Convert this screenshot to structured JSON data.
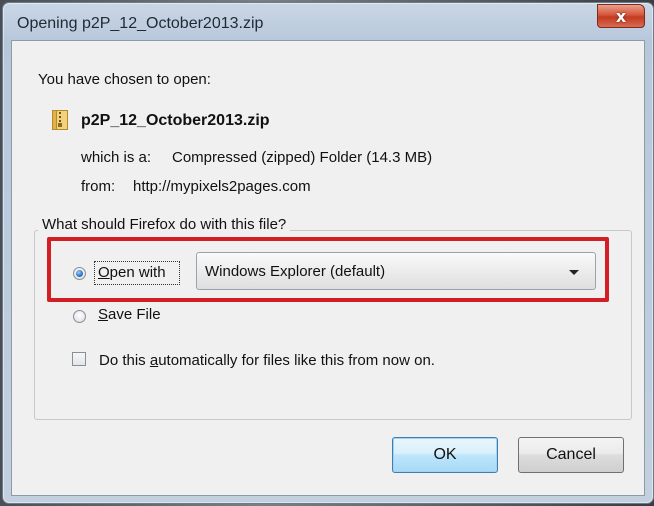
{
  "window": {
    "title": "Opening p2P_12_October2013.zip",
    "close_glyph": "x"
  },
  "dialog": {
    "intro": "You have chosen to open:",
    "filename": "p2P_12_October2013.zip",
    "which_is_label": "which is a:",
    "which_is_value": "Compressed (zipped) Folder (14.3 MB)",
    "from_label": "from:",
    "from_value": "http://mypixels2pages.com"
  },
  "action_group": {
    "legend": "What should Firefox do with this file?",
    "open_with": {
      "accel": "O",
      "rest": "pen with",
      "selected": true
    },
    "app_select": {
      "value": "Windows Explorer (default)"
    },
    "save_file": {
      "accel": "S",
      "rest": "ave File",
      "selected": false
    },
    "auto": {
      "before": "Do this ",
      "accel": "a",
      "after": "utomatically for files like this from now on.",
      "checked": false
    }
  },
  "buttons": {
    "ok": "OK",
    "cancel": "Cancel"
  },
  "colors": {
    "highlight": "#d21e24",
    "titlebar": "#c2d0df",
    "close": "#c23b22"
  },
  "icons": {
    "file": "zip-folder-icon",
    "close": "close-icon",
    "dropdown": "chevron-down-icon"
  }
}
